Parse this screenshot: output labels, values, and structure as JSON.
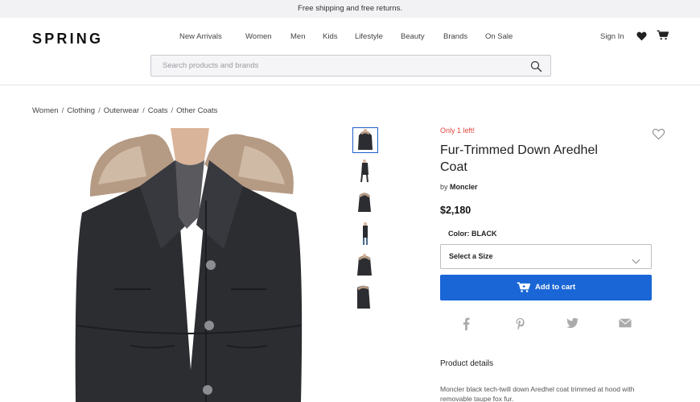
{
  "promo": {
    "text": "Free shipping and free returns."
  },
  "header": {
    "logo": "SPRING",
    "nav": [
      "New Arrivals",
      "Women",
      "Men",
      "Kids",
      "Lifestyle",
      "Beauty",
      "Brands",
      "On Sale"
    ],
    "sign_in": "Sign In",
    "icons": {
      "wishlist": "heart-icon",
      "cart": "cart-icon"
    },
    "search": {
      "placeholder": "Search products and brands",
      "icon": "search-icon"
    }
  },
  "breadcrumb": [
    "Women",
    "Clothing",
    "Outerwear",
    "Coats",
    "Other Coats"
  ],
  "gallery": {
    "thumbnail_count": 6,
    "selected_index": 0
  },
  "product": {
    "stock_note": "Only 1 left!",
    "title": "Fur-Trimmed Down Aredhel Coat",
    "by_label": "by",
    "brand": "Moncler",
    "price": "$2,180",
    "color_label": "Color:",
    "color_value": "BLACK",
    "size_select": "Select a Size",
    "add_to_cart": "Add to cart",
    "share_icons": [
      "facebook-icon",
      "pinterest-icon",
      "twitter-icon",
      "email-icon"
    ],
    "details_heading": "Product details",
    "details_text": "Moncler black tech-twill down Aredhel coat trimmed at hood with removable taupe fox fur."
  },
  "colors": {
    "accent": "#1a66d6",
    "alert": "#e2473a",
    "text": "#222222"
  }
}
